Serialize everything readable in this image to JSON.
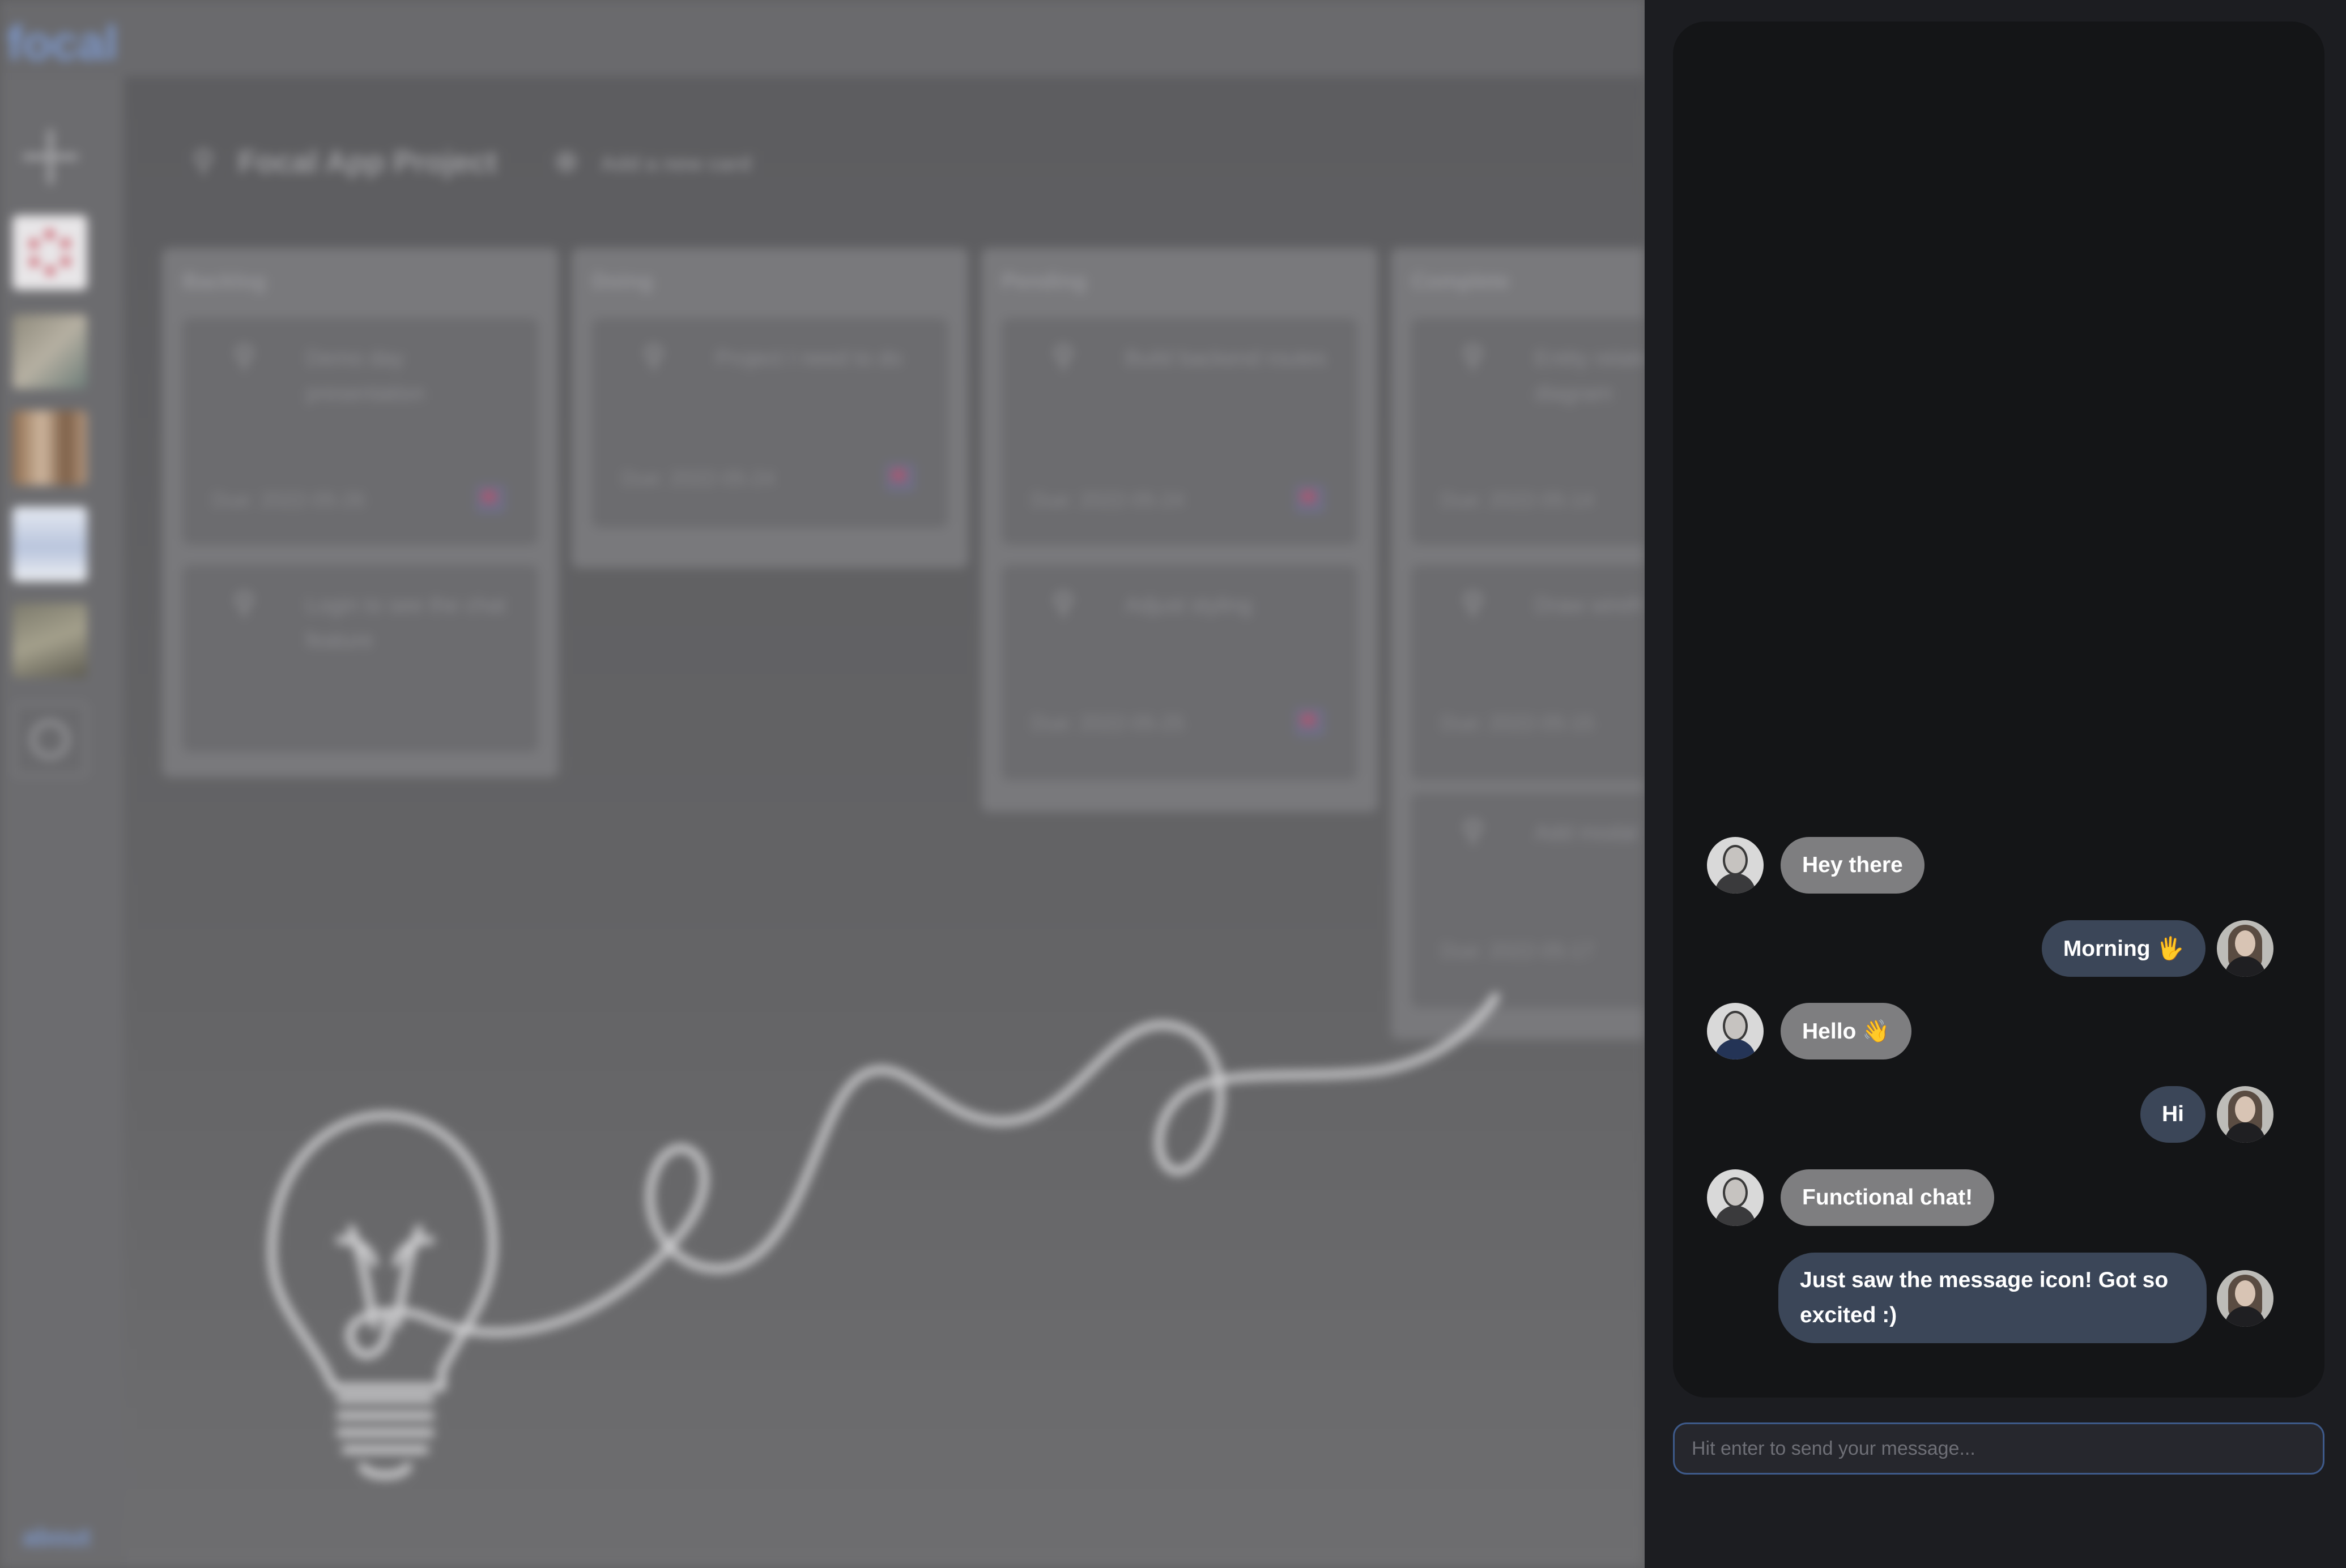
{
  "app": {
    "logo": "focal",
    "about_link": "about"
  },
  "board": {
    "project_title": "Focal App Project",
    "add_card_label": "Add a new card",
    "columns": [
      {
        "title": "Backlog",
        "cards": [
          {
            "title": "Demo day presentation",
            "due": "Due: 2022-05-26",
            "flagged": true
          },
          {
            "title": "Login to see the chat feature",
            "due": "",
            "flagged": false
          }
        ]
      },
      {
        "title": "Doing",
        "cards": [
          {
            "title": "Project I need to do",
            "due": "Due: 2022-05-24",
            "flagged": true
          }
        ]
      },
      {
        "title": "Pending",
        "cards": [
          {
            "title": "Build backend routes",
            "due": "Due: 2022-05-24",
            "flagged": true
          },
          {
            "title": "Adjust styling",
            "due": "Due: 2022-05-25",
            "flagged": true
          }
        ]
      },
      {
        "title": "Complete",
        "cards": [
          {
            "title": "Entity relationship diagram",
            "due": "Due: 2022-05-14",
            "flagged": false
          },
          {
            "title": "Draw wireframes",
            "due": "Due: 2022-05-15",
            "flagged": false
          },
          {
            "title": "Add modal",
            "due": "Due: 2022-05-17",
            "flagged": false
          }
        ]
      }
    ]
  },
  "chat": {
    "messages": [
      {
        "direction": "incoming",
        "text": "Hey there"
      },
      {
        "direction": "outgoing",
        "text": "Morning 🖐"
      },
      {
        "direction": "incoming",
        "text": "Hello 👋"
      },
      {
        "direction": "outgoing",
        "text": "Hi"
      },
      {
        "direction": "incoming",
        "text": "Functional chat!"
      },
      {
        "direction": "outgoing",
        "text": "Just saw the message icon! Got so excited :)"
      }
    ],
    "input_placeholder": "Hit enter to send your message..."
  },
  "colors": {
    "incoming_bubble": "#7e7e80",
    "outgoing_bubble": "#3b4658",
    "panel_bg": "#1c1d21",
    "chat_bg": "#141517",
    "logo_blue": "#7d97c9",
    "input_border": "#3e5a8a"
  }
}
